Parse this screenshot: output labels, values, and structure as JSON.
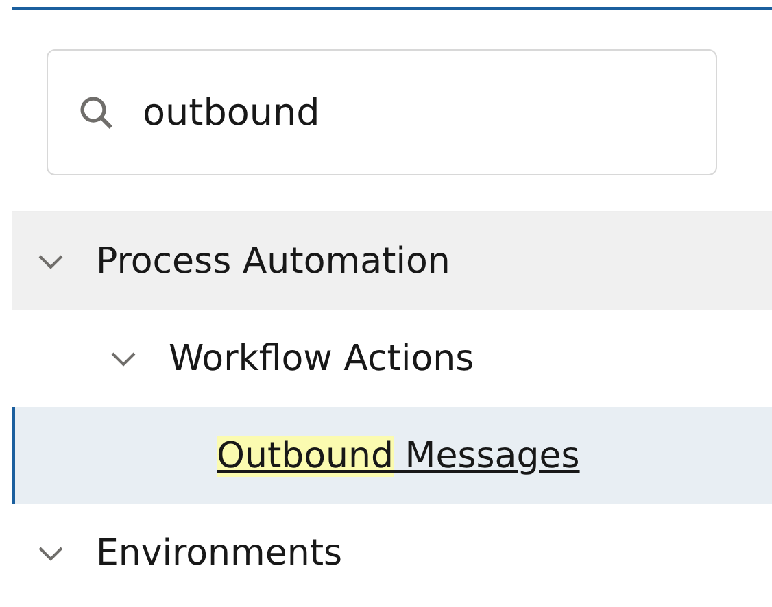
{
  "search": {
    "value": "outbound"
  },
  "tree": [
    {
      "label": "Process Automation",
      "expanded": true,
      "selected": false,
      "hovered": true,
      "children": [
        {
          "label": "Workflow Actions",
          "expanded": true,
          "selected": false,
          "hovered": false,
          "children": [
            {
              "label_parts": [
                {
                  "text": "Outbound",
                  "highlighted": true
                },
                {
                  "text": " Messages",
                  "highlighted": false
                }
              ],
              "link": true,
              "selected": true,
              "hovered": false
            }
          ]
        }
      ]
    },
    {
      "label": "Environments",
      "expanded": true,
      "selected": false,
      "hovered": false
    }
  ]
}
